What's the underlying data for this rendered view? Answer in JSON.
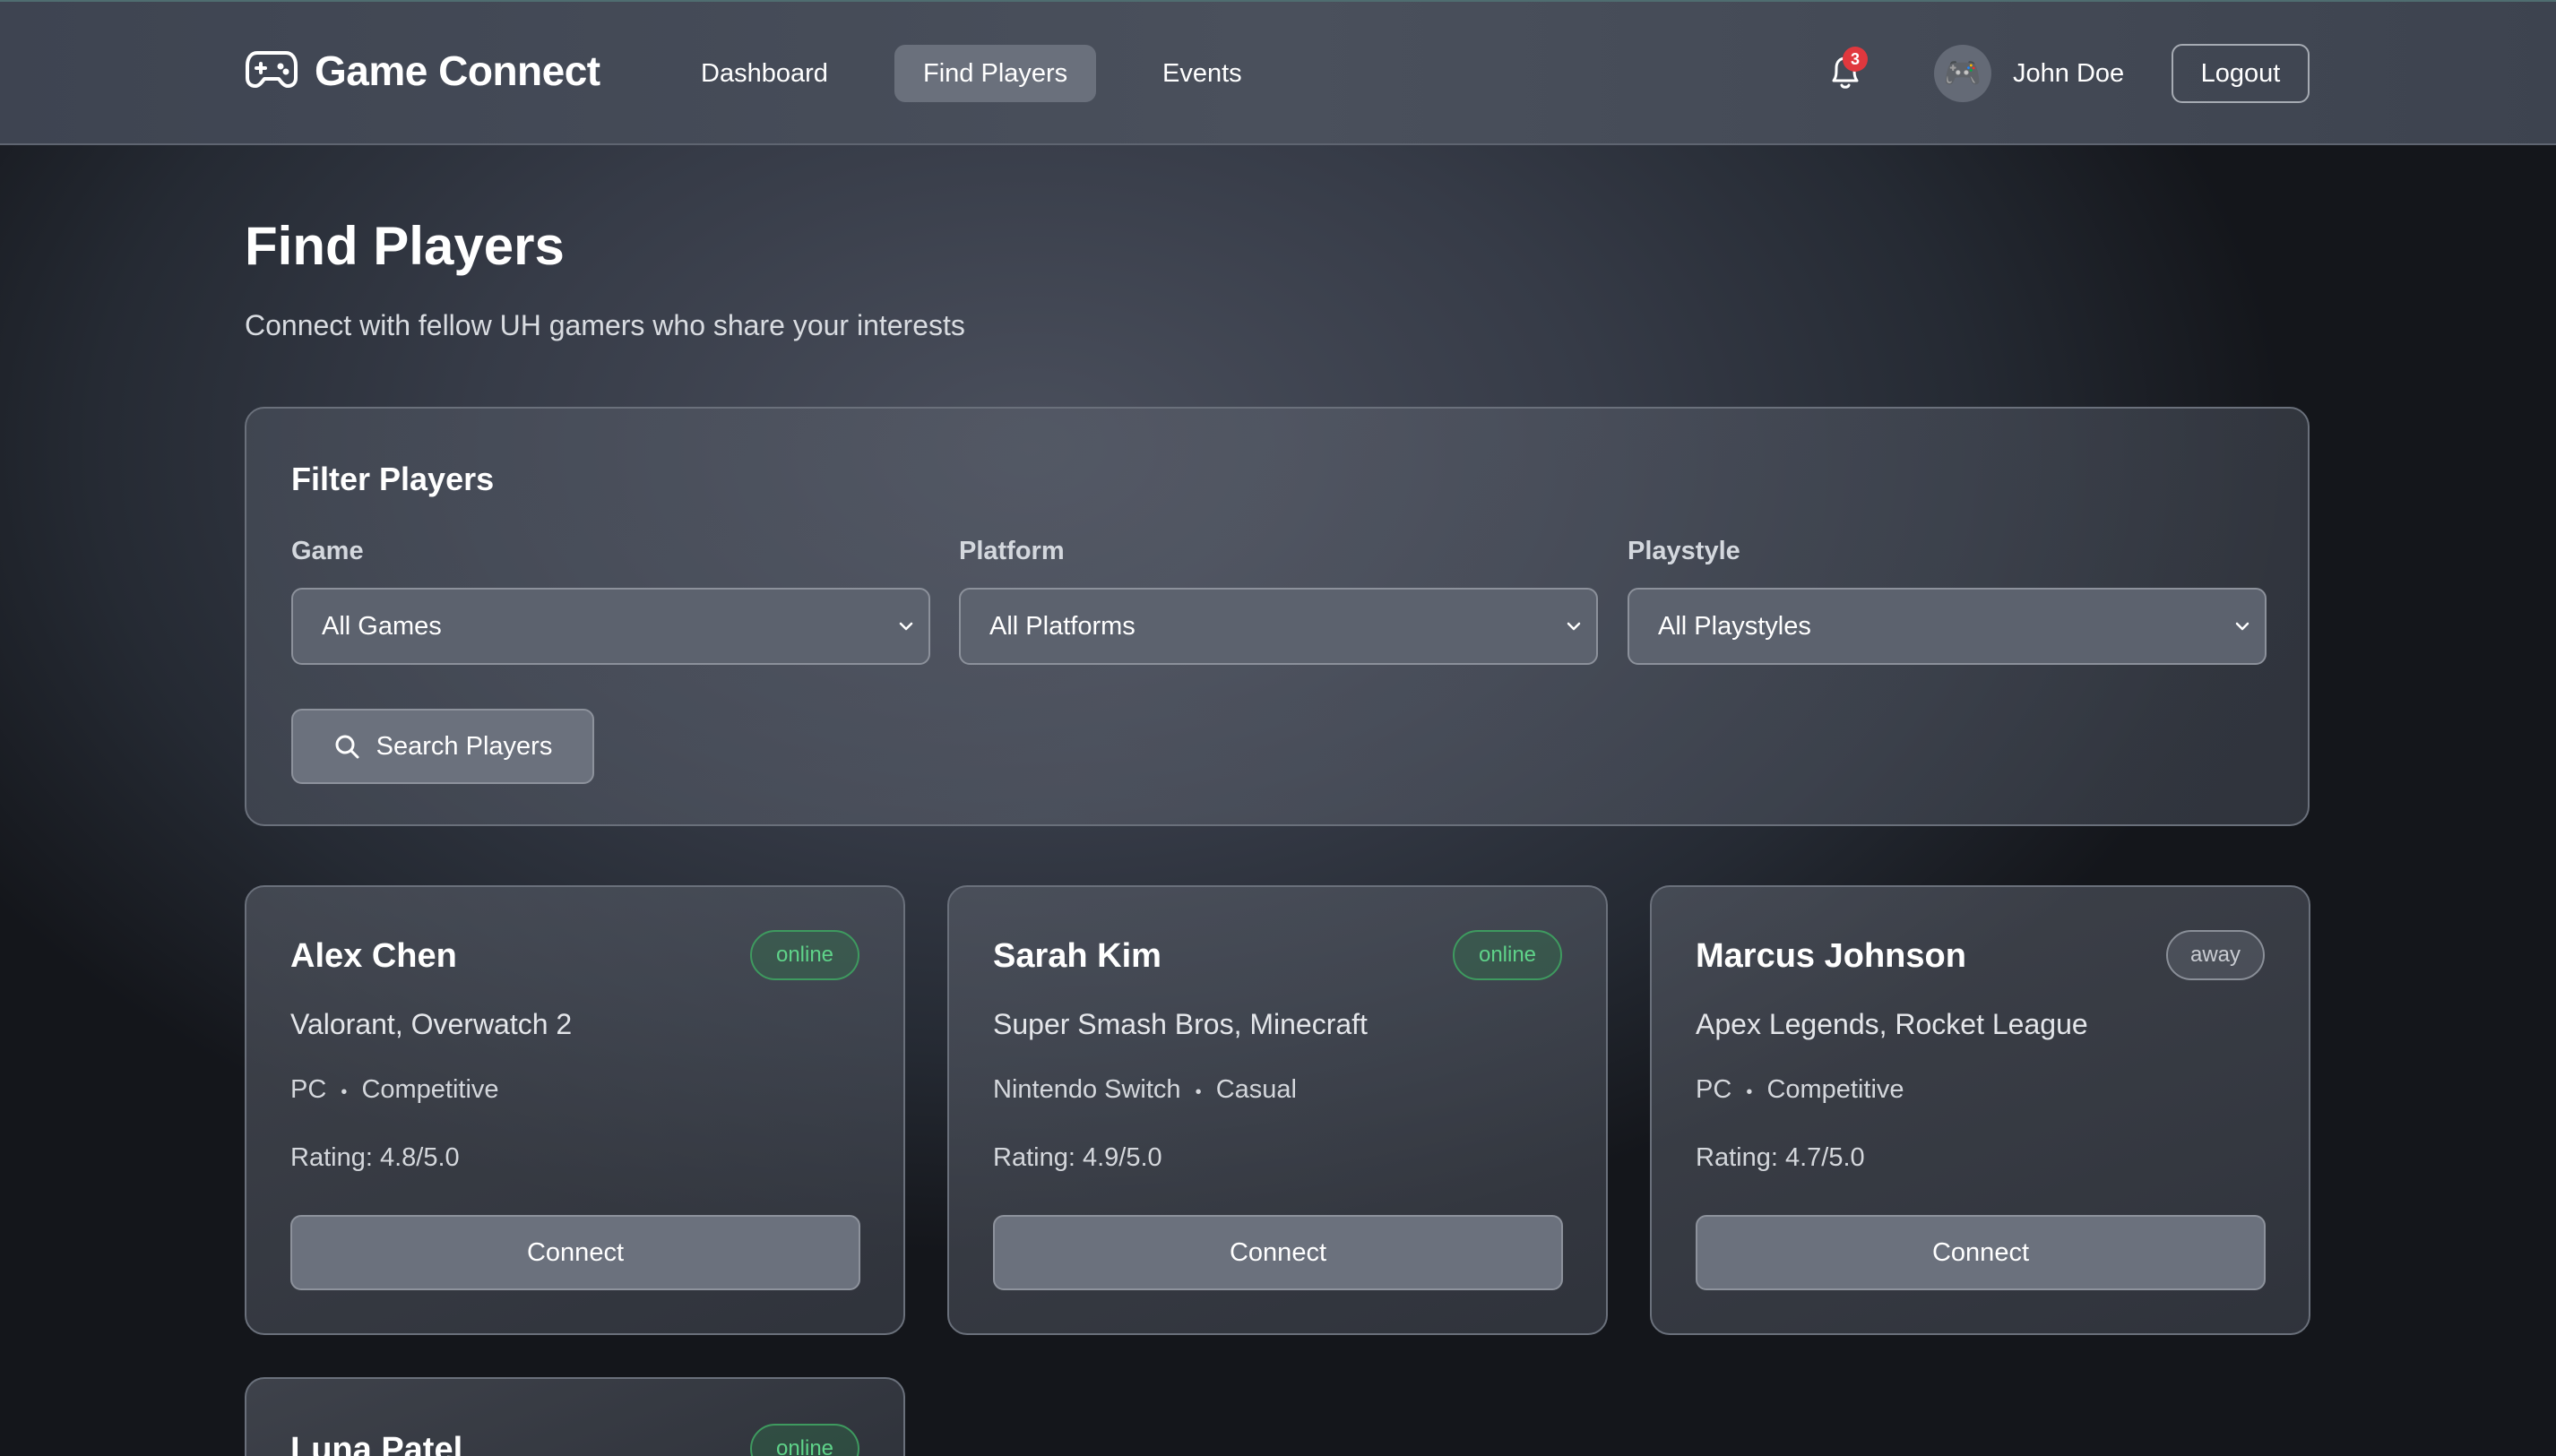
{
  "header": {
    "brand": "Game Connect",
    "nav": [
      {
        "label": "Dashboard",
        "active": false
      },
      {
        "label": "Find Players",
        "active": true
      },
      {
        "label": "Events",
        "active": false
      }
    ],
    "notification_count": "3",
    "user": {
      "name": "John Doe",
      "avatar": "🎮"
    },
    "logout_label": "Logout"
  },
  "page": {
    "title": "Find Players",
    "subtitle": "Connect with fellow UH gamers who share your interests"
  },
  "filters": {
    "title": "Filter Players",
    "game": {
      "label": "Game",
      "value": "All Games"
    },
    "platform": {
      "label": "Platform",
      "value": "All Platforms"
    },
    "playstyle": {
      "label": "Playstyle",
      "value": "All Playstyles"
    },
    "search_label": "Search Players"
  },
  "players": [
    {
      "name": "Alex Chen",
      "status": "online",
      "games": "Valorant, Overwatch 2",
      "platform": "PC",
      "playstyle": "Competitive",
      "rating": "Rating: 4.8/5.0",
      "connect_label": "Connect"
    },
    {
      "name": "Sarah Kim",
      "status": "online",
      "games": "Super Smash Bros, Minecraft",
      "platform": "Nintendo Switch",
      "playstyle": "Casual",
      "rating": "Rating: 4.9/5.0",
      "connect_label": "Connect"
    },
    {
      "name": "Marcus Johnson",
      "status": "away",
      "games": "Apex Legends, Rocket League",
      "platform": "PC",
      "playstyle": "Competitive",
      "rating": "Rating: 4.7/5.0",
      "connect_label": "Connect"
    },
    {
      "name": "Luna Patel",
      "status": "online"
    }
  ],
  "meta_separator": "•",
  "colors": {
    "online": "#5fd389",
    "away": "#c9ccd2",
    "badge": "#e0383e"
  }
}
